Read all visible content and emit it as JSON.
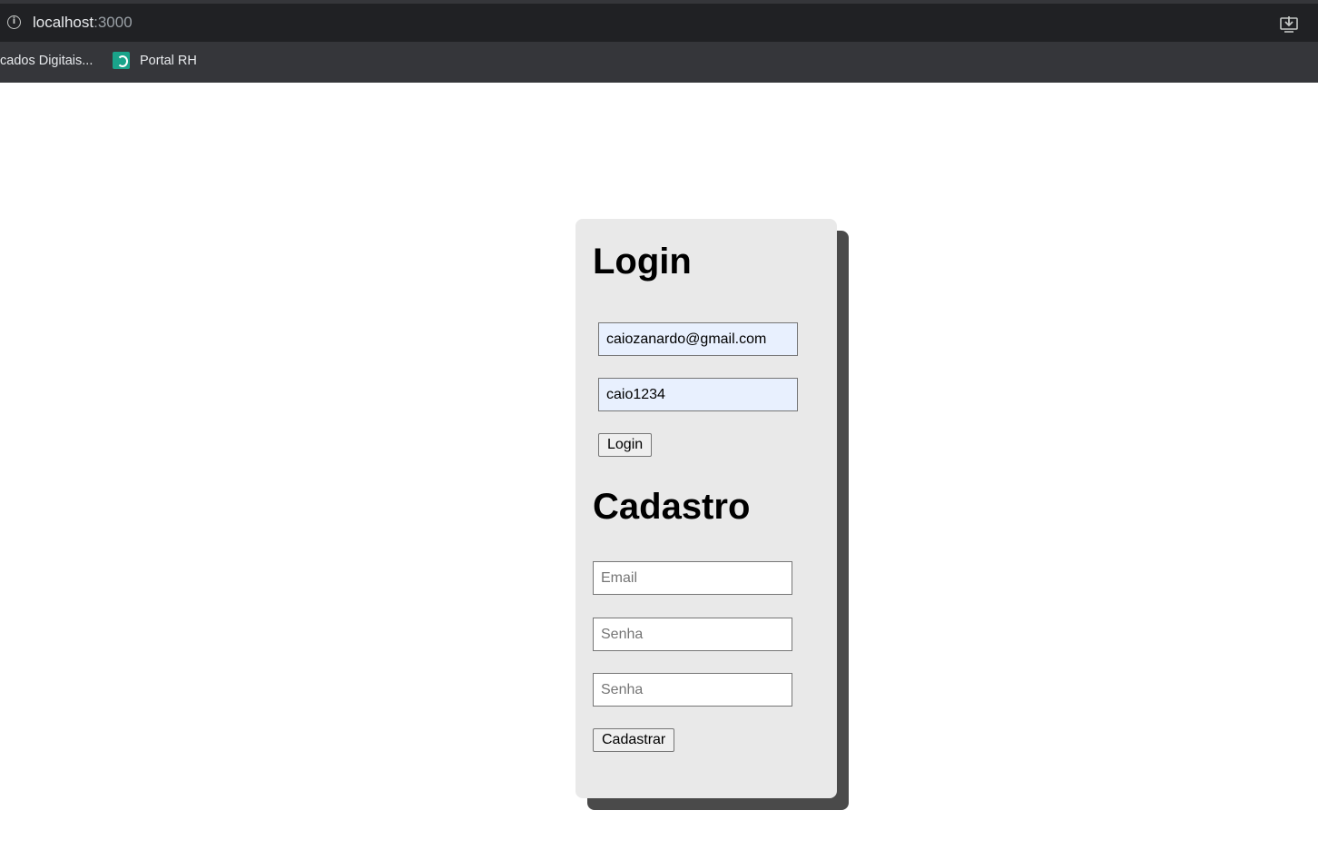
{
  "browser": {
    "url_host": "localhost",
    "url_port": ":3000",
    "bookmarks": [
      {
        "label": "cados Digitais..."
      },
      {
        "label": "Portal RH"
      }
    ]
  },
  "login": {
    "title": "Login",
    "email_value": "caiozanardo@gmail.com",
    "password_value": "caio1234",
    "button_label": "Login"
  },
  "cadastro": {
    "title": "Cadastro",
    "email_placeholder": "Email",
    "password_placeholder": "Senha",
    "password_confirm_placeholder": "Senha",
    "button_label": "Cadastrar"
  },
  "colors": {
    "card_background": "#e9e9e9",
    "card_shadow": "#4a4a4a",
    "autofill_background": "#e8f0fe"
  }
}
